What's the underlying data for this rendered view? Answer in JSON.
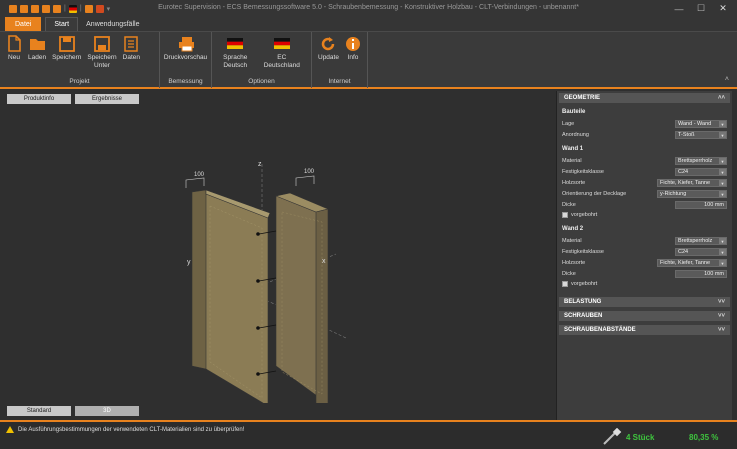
{
  "window": {
    "title": "Eurotec Supervision - ECS Bemessungssoftware 5.0 - Schraubenbemessung - Konstruktiver Holzbau - CLT-Verbindungen - unbenannt*",
    "min": "—",
    "max": "☐",
    "close": "✕"
  },
  "tabs": {
    "file": "Datei",
    "start": "Start",
    "usecases": "Anwendungsfälle"
  },
  "ribbon": {
    "groups": [
      {
        "label": "Projekt",
        "buttons": [
          "Neu",
          "Laden",
          "Speichern",
          "Speichern\nUnter",
          "Daten"
        ]
      },
      {
        "label": "Bemessung",
        "buttons": [
          "Druckvorschau"
        ]
      },
      {
        "label": "Optionen",
        "buttons": [
          "Sprache\nDeutsch",
          "EC\nDeutschland"
        ]
      },
      {
        "label": "Internet",
        "buttons": [
          "Update",
          "Info"
        ]
      }
    ],
    "collapse": "˄"
  },
  "work": {
    "top_tabs": [
      "Produktinfo",
      "Ergebnisse"
    ],
    "bottom_tabs": [
      "Standard",
      "3D"
    ],
    "axes": {
      "z": "z",
      "y": "y",
      "x": "x"
    },
    "dims": [
      "100",
      "100"
    ]
  },
  "panel": {
    "geometry": {
      "title": "GEOMETRIE",
      "chev": "˄˄"
    },
    "bauteile": {
      "title": "Bauteile",
      "lage_label": "Lage",
      "lage": "Wand - Wand",
      "anordnung_label": "Anordnung",
      "anordnung": "T-Stoß"
    },
    "wand1": {
      "title": "Wand 1",
      "material_label": "Material",
      "material": "Brettsperrholz",
      "fk_label": "Festigkeitsklasse",
      "fk": "C24",
      "holz_label": "Holzsorte",
      "holz": "Fichte, Kiefer, Tanne",
      "ori_label": "Orientierung der Decklage",
      "ori": "y-Richtung",
      "dicke_label": "Dicke",
      "dicke": "100 mm",
      "vorgebohrt": "vorgebohrt"
    },
    "wand2": {
      "title": "Wand 2",
      "material_label": "Material",
      "material": "Brettsperrholz",
      "fk_label": "Festigkeitsklasse",
      "fk": "C24",
      "holz_label": "Holzsorte",
      "holz": "Fichte, Kiefer, Tanne",
      "dicke_label": "Dicke",
      "dicke": "100 mm",
      "vorgebohrt": "vorgebohrt"
    },
    "sections": [
      {
        "title": "BELASTUNG",
        "chev": "˅˅"
      },
      {
        "title": "SCHRAUBEN",
        "chev": "˅˅"
      },
      {
        "title": "SCHRAUBENABSTÄNDE",
        "chev": "˅˅"
      }
    ]
  },
  "status": {
    "warning": "Die Ausführungsbestimmungen der verwendeten CLT-Materialien sind zu überprüfen!",
    "count": "4 Stück",
    "percent": "80,35 %"
  },
  "colors": {
    "accent": "#e8821e",
    "ok": "#3ec43e",
    "wood": "#8b7c55"
  }
}
